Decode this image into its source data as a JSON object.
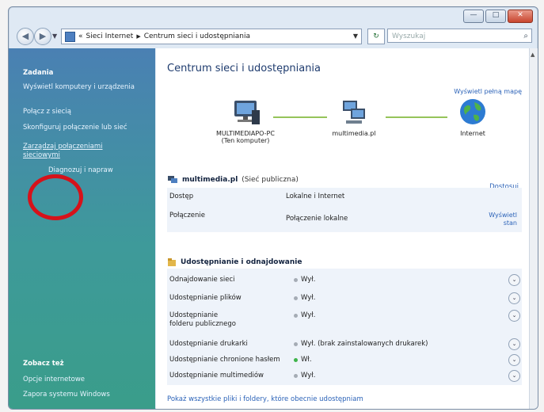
{
  "window_controls": {
    "minimize": "—",
    "maximize": "□",
    "close": "✕"
  },
  "address_bar": {
    "back": "◀",
    "forward": "▶",
    "recent": "▼",
    "chevron": "«",
    "path": [
      "Sieci Internet",
      "Centrum sieci i udostępniania"
    ],
    "sep": "▶",
    "dropdown": "▼",
    "refresh": "↻",
    "search_placeholder": "Wyszukaj",
    "search_icon": "⌕"
  },
  "sidebar": {
    "title": "Zadania",
    "items": [
      "Wyświetl komputery i urządzenia",
      "Połącz z siecią",
      "Skonfiguruj połączenie lub sieć",
      "Zarządzaj połączeniami sieciowymi",
      "Diagnozuj i napraw"
    ],
    "see_also": "Zobacz też",
    "see_items": [
      "Opcje internetowe",
      "Zapora systemu Windows"
    ]
  },
  "main": {
    "title": "Centrum sieci i udostępniania",
    "full_map_link": "Wyświetl pełną mapę",
    "map_nodes": [
      {
        "label": "MULTIMEDIAPO-PC",
        "sub": "(Ten komputer)"
      },
      {
        "label": "multimedia.pl",
        "sub": ""
      },
      {
        "label": "Internet",
        "sub": ""
      }
    ],
    "network": {
      "name": "multimedia.pl",
      "type": "(Sieć publiczna)",
      "customize": "Dostosuj",
      "rows": [
        {
          "label": "Dostęp",
          "value": "Lokalne i Internet"
        },
        {
          "label": "Połączenie",
          "value": "Połączenie lokalne",
          "action": "Wyświetl stan"
        }
      ]
    },
    "sharing": {
      "title": "Udostępnianie i odnajdowanie",
      "rows": [
        {
          "label": "Odnajdowanie sieci",
          "value": "Wył.",
          "on": false
        },
        {
          "label": "Udostępnianie plików",
          "value": "Wył.",
          "on": false
        },
        {
          "label": "Udostępnianie folderu publicznego",
          "value": "Wył.",
          "on": false
        },
        {
          "label": "Udostępnianie drukarki",
          "value": "Wył. (brak zainstalowanych drukarek)",
          "on": false
        },
        {
          "label": "Udostępnianie chronione hasłem",
          "value": "Wł.",
          "on": true
        },
        {
          "label": "Udostępnianie multimediów",
          "value": "Wył.",
          "on": false
        }
      ],
      "expand": "⌄"
    },
    "bottom_links": [
      "Pokaż wszystkie pliki i foldery, które obecnie udostępniam"
    ]
  }
}
